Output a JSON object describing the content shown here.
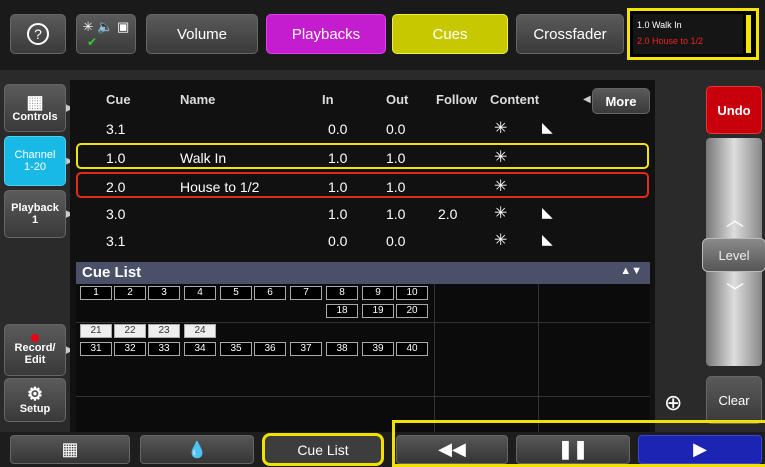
{
  "topbar": {
    "help_icon": "?",
    "volume": "Volume",
    "playbacks": "Playbacks",
    "cues": "Cues",
    "crossfader": "Crossfader",
    "xfade_line1": "1.0 Walk In",
    "xfade_line2": "2.0 House to 1/2"
  },
  "sidebar": {
    "controls": "Controls",
    "channel_1": "Channel",
    "channel_2": "1-20",
    "playback_1": "Playback",
    "playback_2": "1",
    "record_1": "Record/",
    "record_2": "Edit",
    "setup": "Setup"
  },
  "table": {
    "headers": [
      "Cue",
      "Name",
      "In",
      "Out",
      "Follow",
      "Content"
    ],
    "more": "More",
    "rows": [
      {
        "cue": "3.1",
        "name": "",
        "in": "0.0",
        "out": "0.0",
        "follow": "",
        "boat": true
      },
      {
        "cue": "1.0",
        "name": "Walk In",
        "in": "1.0",
        "out": "1.0",
        "follow": "",
        "boat": false
      },
      {
        "cue": "2.0",
        "name": "House to 1/2",
        "in": "1.0",
        "out": "1.0",
        "follow": "",
        "boat": false
      },
      {
        "cue": "3.0",
        "name": "",
        "in": "1.0",
        "out": "1.0",
        "follow": "2.0",
        "boat": true
      },
      {
        "cue": "3.1",
        "name": "",
        "in": "0.0",
        "out": "0.0",
        "follow": "",
        "boat": true
      }
    ]
  },
  "cuelist": {
    "title": "Cue List",
    "row1": [
      "1",
      "2",
      "3",
      "4",
      "5",
      "6",
      "7",
      "8",
      "9",
      "10"
    ],
    "row1b": [
      "18",
      "19",
      "20"
    ],
    "row2top": [
      "21",
      "22",
      "23",
      "24"
    ],
    "row2": [
      "31",
      "32",
      "33",
      "34",
      "35",
      "36",
      "37",
      "38",
      "39",
      "40"
    ]
  },
  "right": {
    "undo": "Undo",
    "level": "Level",
    "clear": "Clear"
  },
  "bottombar": {
    "cue_list": "Cue List"
  },
  "colors": {
    "playbacks": "#c41ccf",
    "cues": "#c8c800",
    "channel": "#19b9e6",
    "undo": "#c8000b",
    "play": "#1c24b4",
    "highlight": "#f0e100",
    "selected_red": "#e52a1a"
  }
}
